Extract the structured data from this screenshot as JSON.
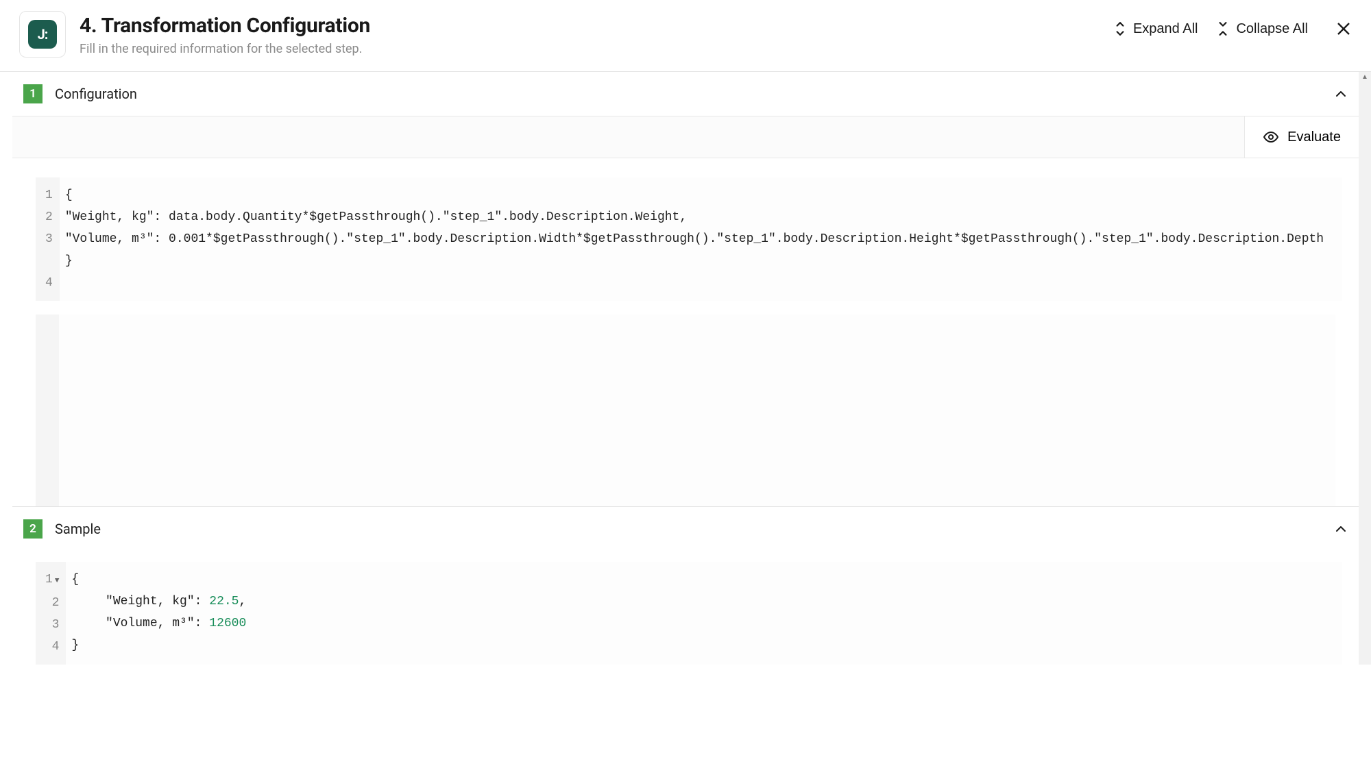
{
  "header": {
    "logo_text": "J:",
    "title": "4. Transformation Configuration",
    "subtitle": "Fill in the required information for the selected step.",
    "expand_all": "Expand All",
    "collapse_all": "Collapse All"
  },
  "sections": {
    "configuration": {
      "badge": "1",
      "title": "Configuration",
      "evaluate_label": "Evaluate",
      "code": {
        "lines": [
          {
            "n": "1",
            "text": "{"
          },
          {
            "n": "2",
            "text": "\"Weight, kg\": data.body.Quantity*$getPassthrough().\"step_1\".body.Description.Weight,"
          },
          {
            "n": "3",
            "text": "\"Volume, m³\": 0.001*$getPassthrough().\"step_1\".body.Description.Width*$getPassthrough().\"step_1\".body.Description.Height*$getPassthrough().\"step_1\".body.Description.Depth"
          },
          {
            "n": "4",
            "text": "}"
          }
        ]
      }
    },
    "sample": {
      "badge": "2",
      "title": "Sample",
      "code": {
        "line1_n": "1",
        "line1_text": "{",
        "line2_n": "2",
        "line2_key": "  \"Weight, kg\": ",
        "line2_val": "22.5",
        "line2_after": ",",
        "line3_n": "3",
        "line3_key": "  \"Volume, m³\": ",
        "line3_val": "12600",
        "line4_n": "4",
        "line4_text": "}"
      }
    }
  }
}
